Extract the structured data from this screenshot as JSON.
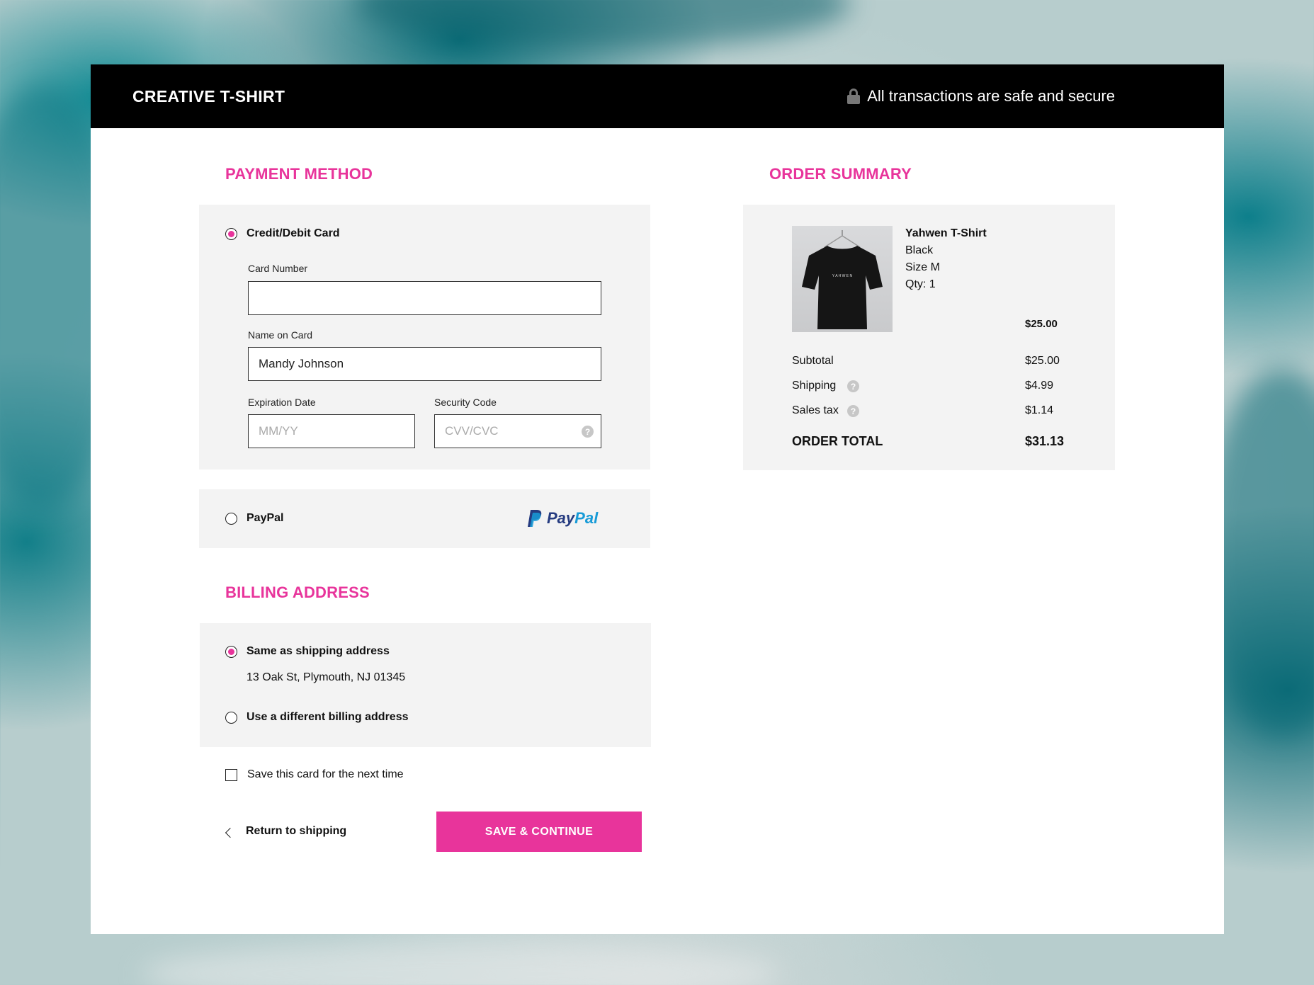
{
  "header": {
    "brand": "CREATIVE T-SHIRT",
    "secure_text": "All transactions are safe and secure",
    "secure_icon": "lock-icon"
  },
  "payment": {
    "title": "PAYMENT METHOD",
    "card_option": {
      "label": "Credit/Debit Card",
      "selected": true,
      "card_number_label": "Card Number",
      "card_number_value": "",
      "name_label": "Name on Card",
      "name_value": "Mandy Johnson",
      "expiry_label": "Expiration Date",
      "expiry_placeholder": "MM/YY",
      "security_label": "Security Code",
      "security_placeholder": "CVV/CVC",
      "security_help_icon": "question-icon"
    },
    "paypal_option": {
      "label": "PayPal",
      "selected": false,
      "logo_pay": "Pay",
      "logo_pal": "Pal"
    }
  },
  "billing": {
    "title": "BILLING ADDRESS",
    "same_label": "Same as shipping address",
    "same_selected": true,
    "address": "13 Oak St, Plymouth, NJ 01345",
    "different_label": "Use a different billing address",
    "different_selected": false
  },
  "save_card": {
    "label": "Save this card for the next time",
    "checked": false
  },
  "actions": {
    "back_label": "Return to shipping",
    "continue_label": "SAVE & CONTINUE"
  },
  "summary": {
    "title": "ORDER SUMMARY",
    "item": {
      "name": "Yahwen T-Shirt",
      "color": "Black",
      "size": "Size M",
      "qty": "Qty: 1",
      "price": "$25.00",
      "shirt_print": "Y A H W E N"
    },
    "rows": [
      {
        "label": "Subtotal",
        "value": "$25.00",
        "help": false
      },
      {
        "label": "Shipping",
        "value": "$4.99",
        "help": true
      },
      {
        "label": "Sales tax",
        "value": "$1.14",
        "help": true
      }
    ],
    "total_label": "ORDER TOTAL",
    "total_value": "$31.13"
  },
  "colors": {
    "accent": "#e8349b",
    "header_bg": "#000000",
    "panel_bg": "#f3f3f3"
  }
}
